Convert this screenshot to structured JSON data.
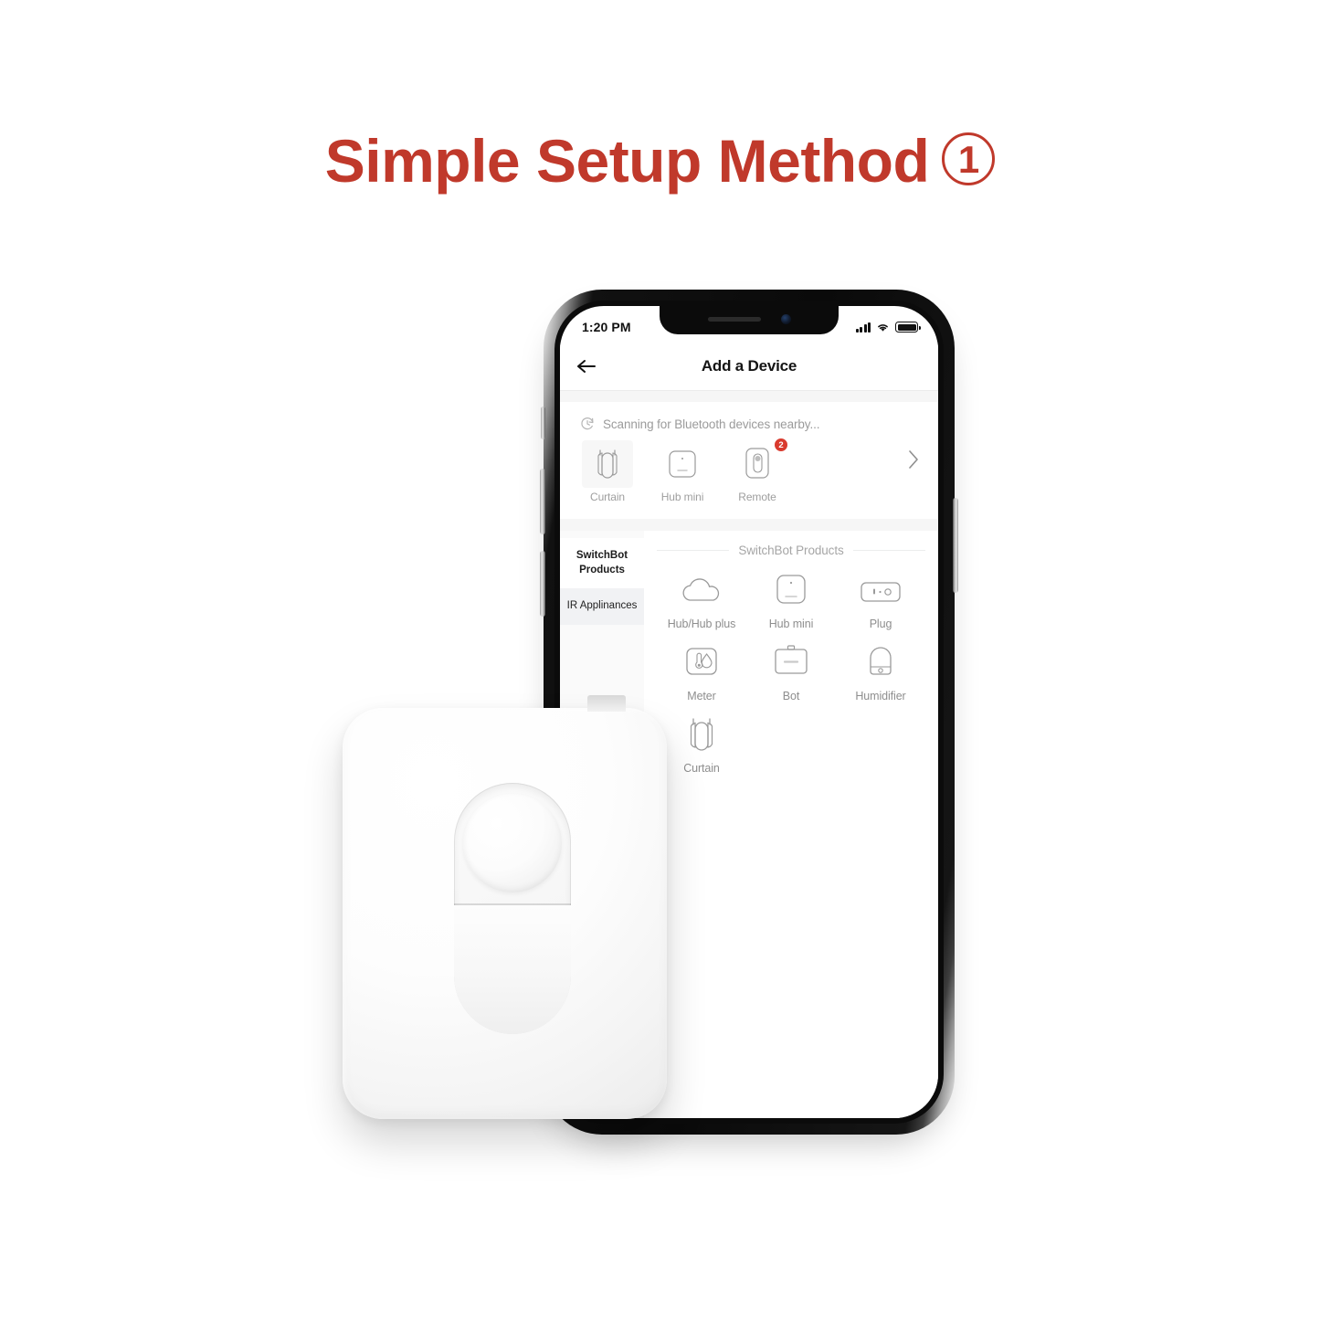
{
  "headline": {
    "text": "Simple Setup Method",
    "step_number": "1",
    "color": "#c0392b"
  },
  "phone": {
    "status_bar": {
      "time": "1:20 PM",
      "signal_icon": "cellular-signal-icon",
      "wifi_icon": "wifi-icon",
      "battery_icon": "battery-full-icon"
    },
    "nav": {
      "back_icon": "arrow-left-icon",
      "title": "Add a Device"
    },
    "scanning": {
      "icon": "scan-clock-icon",
      "label": "Scanning for Bluetooth devices nearby...",
      "chevron_icon": "chevron-right-icon",
      "devices": [
        {
          "label": "Curtain",
          "icon": "curtain-icon",
          "badge": ""
        },
        {
          "label": "Hub mini",
          "icon": "hub-mini-icon",
          "badge": ""
        },
        {
          "label": "Remote",
          "icon": "bot-icon",
          "badge": "2"
        }
      ]
    },
    "catalog": {
      "sidebar": [
        {
          "label": "SwitchBot Products",
          "active": true
        },
        {
          "label": "IR Applinances",
          "active": false
        }
      ],
      "section_title": "SwitchBot Products",
      "products": [
        {
          "label": "Hub/Hub plus",
          "icon": "cloud-hub-icon"
        },
        {
          "label": "Hub mini",
          "icon": "hub-mini-icon"
        },
        {
          "label": "Plug",
          "icon": "plug-icon"
        },
        {
          "label": "Meter",
          "icon": "meter-icon"
        },
        {
          "label": "Bot",
          "icon": "bot-square-icon"
        },
        {
          "label": "Humidifier",
          "icon": "humidifier-icon"
        },
        {
          "label": "Curtain",
          "icon": "curtain-icon"
        }
      ]
    }
  },
  "product_photo": {
    "name": "switchbot-bot-device",
    "color": "#ffffff"
  }
}
